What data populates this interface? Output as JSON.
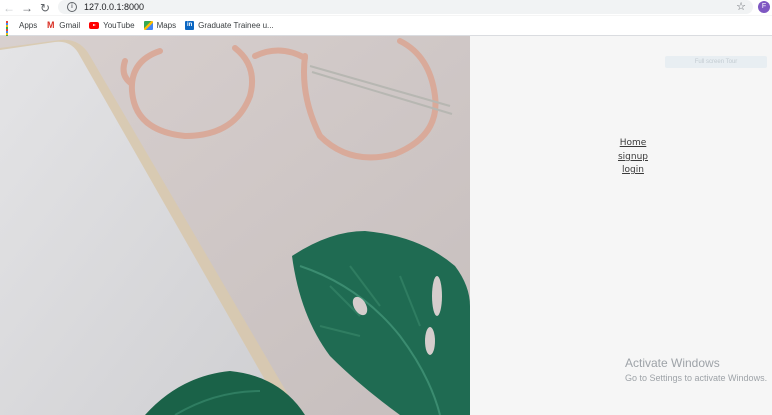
{
  "browser": {
    "url": "127.0.0.1:8000",
    "profile_initial": "F",
    "bookmarks": [
      {
        "label": "Apps",
        "icon": "apps-grid-icon"
      },
      {
        "label": "Gmail",
        "icon": "gmail-icon"
      },
      {
        "label": "YouTube",
        "icon": "youtube-icon"
      },
      {
        "label": "Maps",
        "icon": "maps-icon"
      },
      {
        "label": "Graduate Trainee u...",
        "icon": "linkedin-icon"
      }
    ]
  },
  "page": {
    "fullscreen_label": "Full screen Tour",
    "nav": {
      "home": "Home",
      "signup": "signup",
      "login": "login"
    }
  },
  "overlay": {
    "activate_title": "Activate Windows",
    "activate_sub": "Go to Settings to activate Windows."
  },
  "colors": {
    "avatar": "#7e57c2",
    "hero_background": "#cfc7c5",
    "panel_background": "#f6f6f6",
    "leaf": "#1f6b52"
  }
}
